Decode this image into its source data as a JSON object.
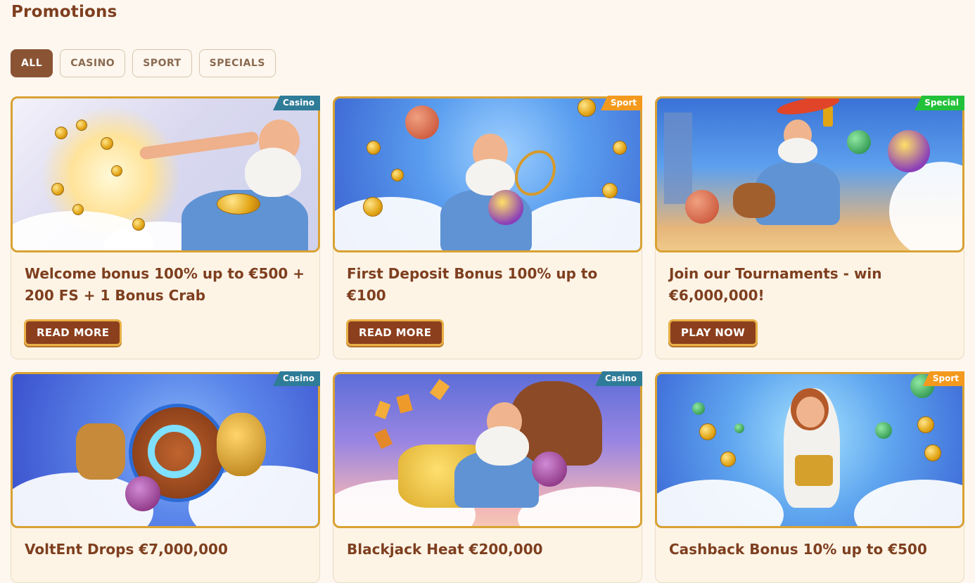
{
  "page": {
    "title": "Promotions"
  },
  "filters": [
    {
      "label": "ALL",
      "active": true
    },
    {
      "label": "CASINO",
      "active": false
    },
    {
      "label": "SPORT",
      "active": false
    },
    {
      "label": "SPECIALS",
      "active": false
    }
  ],
  "cards": [
    {
      "tag": "Casino",
      "title": "Welcome bonus 100% up to €500 + 200 FS + 1 Bonus Crab",
      "cta": "READ MORE",
      "image": "zeus-coins-casino-image"
    },
    {
      "tag": "Sport",
      "title": "First Deposit Bonus 100% up to €100",
      "cta": "READ MORE",
      "image": "zeus-sports-balls-image"
    },
    {
      "tag": "Special",
      "title": "Join our Tournaments - win €6,000,000!",
      "cta": "PLAY NOW",
      "image": "zeus-torch-running-image"
    },
    {
      "tag": "Casino",
      "title": "VoltEnt Drops €7,000,000",
      "image": "voltent-drops-shield-image"
    },
    {
      "tag": "Casino",
      "title": "Blackjack Heat €200,000",
      "image": "zeus-blackjack-gold-image"
    },
    {
      "tag": "Sport",
      "title": "Cashback Bonus 10% up to €500",
      "image": "athena-tennis-cashback-image"
    }
  ],
  "colors": {
    "background": "#fdf7ef",
    "accent": "#8a5434",
    "title": "#7e3f1f",
    "casino_tag": "#2f7c98",
    "sport_tag": "#f39a1e",
    "special_tag": "#22c13a",
    "banner_border": "#d9a233"
  }
}
